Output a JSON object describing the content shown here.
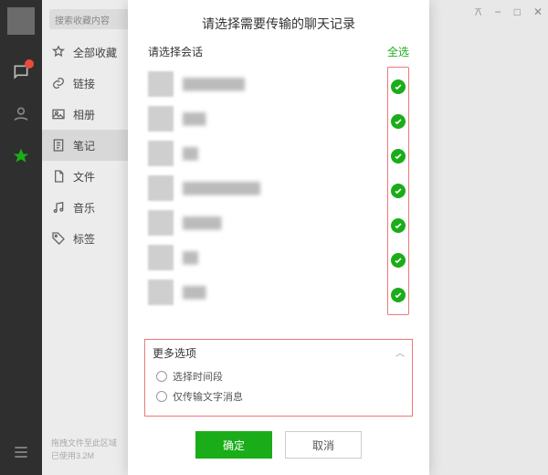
{
  "rail": {
    "icons": [
      "chat",
      "contacts",
      "favorites"
    ],
    "badge_on": 0
  },
  "sidebar": {
    "search_placeholder": "搜索收藏内容",
    "items": [
      {
        "icon": "star",
        "label": "全部收藏"
      },
      {
        "icon": "link",
        "label": "链接"
      },
      {
        "icon": "image",
        "label": "相册"
      },
      {
        "icon": "note",
        "label": "笔记"
      },
      {
        "icon": "file",
        "label": "文件"
      },
      {
        "icon": "music",
        "label": "音乐"
      },
      {
        "icon": "tag",
        "label": "标签"
      }
    ],
    "active_index": 3,
    "hint_line1": "拖拽文件至此区域",
    "hint_line2": "已使用3.2M"
  },
  "window_controls": [
    "⚻",
    "−",
    "□",
    "✕"
  ],
  "dialog": {
    "title": "请选择需要传输的聊天记录",
    "select_label": "请选择会话",
    "select_all": "全选",
    "conversations": [
      {
        "name": "████████"
      },
      {
        "name": "███"
      },
      {
        "name": "██"
      },
      {
        "name": "██████████"
      },
      {
        "name": "█████"
      },
      {
        "name": "██"
      },
      {
        "name": "███"
      }
    ],
    "more": {
      "header": "更多选项",
      "options": [
        "选择时间段",
        "仅传输文字消息"
      ]
    },
    "ok": "确定",
    "cancel": "取消"
  },
  "colors": {
    "accent": "#1aad19",
    "outline": "#e77"
  }
}
